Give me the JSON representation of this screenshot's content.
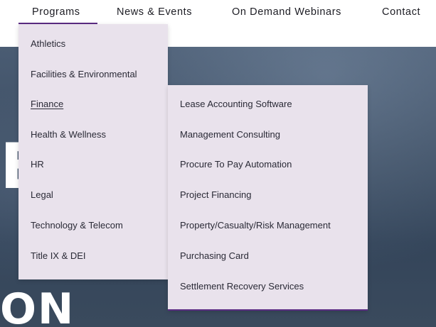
{
  "topnav": {
    "items": [
      {
        "label": "Programs"
      },
      {
        "label": "News & Events"
      },
      {
        "label": "On Demand Webinars"
      },
      {
        "label": "Contact"
      }
    ]
  },
  "programs_menu": {
    "items": [
      {
        "label": "Athletics"
      },
      {
        "label": "Facilities & Environmental"
      },
      {
        "label": "Finance"
      },
      {
        "label": "Health & Wellness"
      },
      {
        "label": "HR"
      },
      {
        "label": "Legal"
      },
      {
        "label": "Technology & Telecom"
      },
      {
        "label": "Title IX & DEI"
      }
    ]
  },
  "finance_submenu": {
    "items": [
      {
        "label": "Lease Accounting Software"
      },
      {
        "label": "Management Consulting"
      },
      {
        "label": "Procure To Pay Automation"
      },
      {
        "label": "Project Financing"
      },
      {
        "label": "Property/Casualty/Risk Management"
      },
      {
        "label": "Purchasing Card"
      },
      {
        "label": "Settlement Recovery Services"
      }
    ]
  },
  "hero": {
    "big_text": "ON",
    "edge_text": "E"
  },
  "colors": {
    "accent": "#5b2c83",
    "dropdown_bg": "#e9e2ec"
  }
}
